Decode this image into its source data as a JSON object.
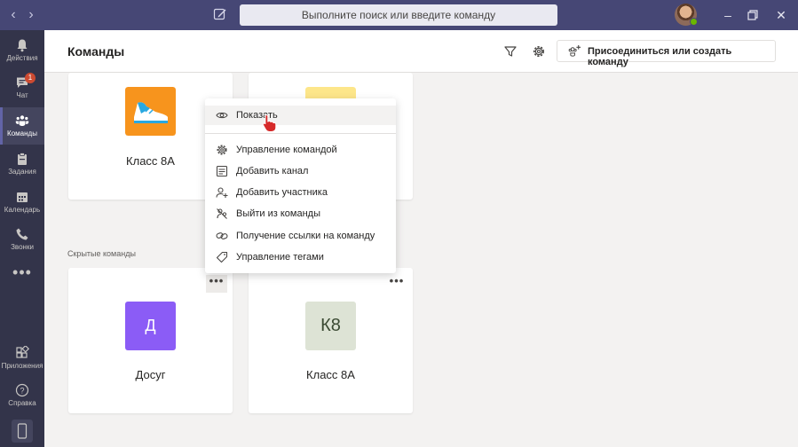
{
  "topbar": {
    "search_placeholder": "Выполните поиск или введите команду",
    "colors": {
      "bar": "#464775",
      "presence": "#6bb700"
    }
  },
  "rail": {
    "items": [
      {
        "label": "Действия",
        "icon": "bell-icon"
      },
      {
        "label": "Чат",
        "icon": "chat-icon",
        "badge": "1"
      },
      {
        "label": "Команды",
        "icon": "teams-icon",
        "active": true
      },
      {
        "label": "Задания",
        "icon": "assignments-icon"
      },
      {
        "label": "Календарь",
        "icon": "calendar-icon"
      },
      {
        "label": "Звонки",
        "icon": "phone-icon"
      },
      {
        "label": "Приложения",
        "icon": "apps-icon"
      },
      {
        "label": "Справка",
        "icon": "help-icon"
      }
    ],
    "more": "•••"
  },
  "header": {
    "title": "Команды",
    "join_button": "Присоединиться или создать команду"
  },
  "sections": {
    "hidden_label": "Скрытые команды"
  },
  "teams": [
    {
      "name": "Класс 8А",
      "tile": "sneaker-image"
    },
    {
      "name": "",
      "tile": "rainbow-image"
    }
  ],
  "hidden_teams": [
    {
      "name": "Досуг",
      "initial": "Д",
      "color": "#8b5cf6",
      "text_color": "#ffffff"
    },
    {
      "name": "Класс 8А",
      "initial": "К8",
      "color": "#dde3d5",
      "text_color": "#3b4a33"
    }
  ],
  "menu": {
    "items": [
      {
        "label": "Показать",
        "icon": "eye-icon"
      },
      {
        "label": "Управление командой",
        "icon": "gear-icon"
      },
      {
        "label": "Добавить канал",
        "icon": "channel-icon"
      },
      {
        "label": "Добавить участника",
        "icon": "add-person-icon"
      },
      {
        "label": "Выйти из команды",
        "icon": "leave-icon"
      },
      {
        "label": "Получение ссылки на команду",
        "icon": "link-icon"
      },
      {
        "label": "Управление тегами",
        "icon": "tag-icon"
      }
    ]
  }
}
